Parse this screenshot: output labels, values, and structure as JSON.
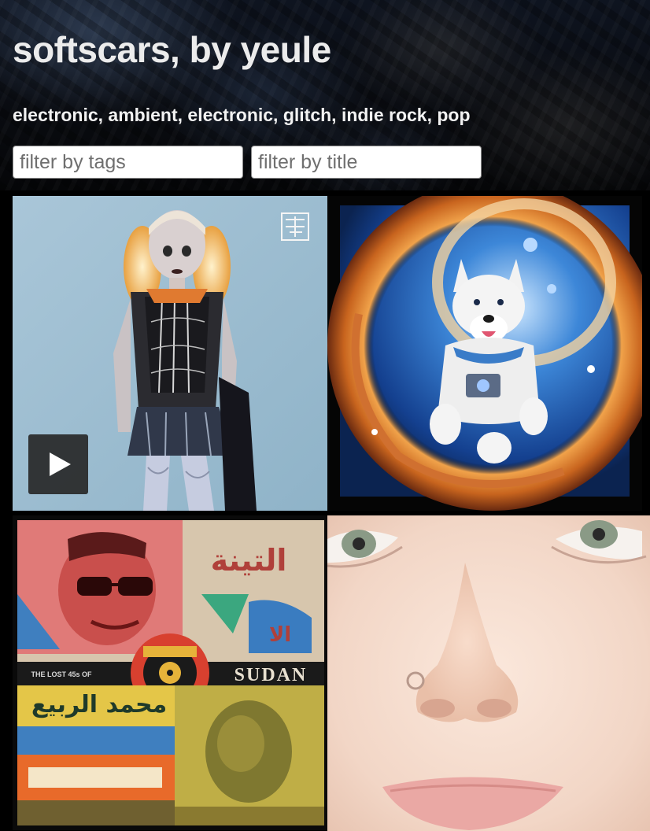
{
  "header": {
    "title": "softscars, by yeule",
    "tags": "electronic, ambient, electronic, glitch, indie rock, pop"
  },
  "filters": {
    "tags_placeholder": "filter by tags",
    "title_placeholder": "filter by title"
  },
  "albums": [
    {
      "name": "softscars-cover",
      "playing_control": "play-icon"
    },
    {
      "name": "space-dog-cover"
    },
    {
      "name": "sudan-compilation-cover",
      "cover_text": "SUDAN",
      "cover_arabic": "التينة",
      "cover_small": "THE LOST 45s OF"
    },
    {
      "name": "face-closeup-cover"
    }
  ],
  "colors": {
    "page_background": "#000000",
    "title_text": "#ececec",
    "play_button_bg": "#282828"
  }
}
